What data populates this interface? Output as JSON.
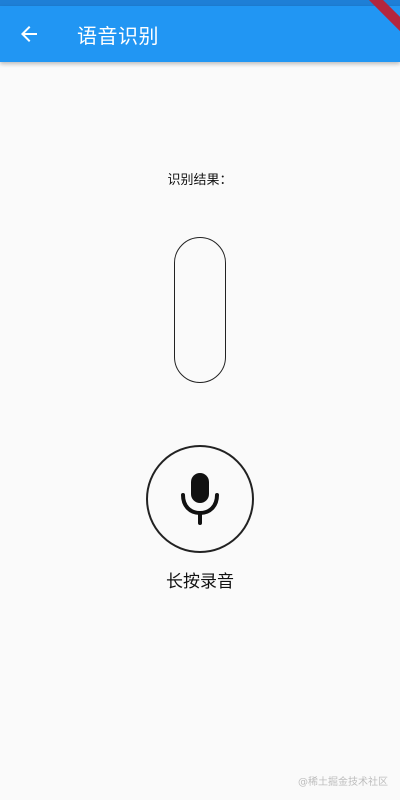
{
  "app_bar": {
    "title": "语音识别",
    "back_icon": "arrow-back-icon",
    "color": "#2196f3"
  },
  "main": {
    "result_label": "识别结果：",
    "mic_icon": "microphone-icon",
    "record_label": "长按录音"
  },
  "watermark": {
    "text": "@稀土掘金技术社区"
  }
}
